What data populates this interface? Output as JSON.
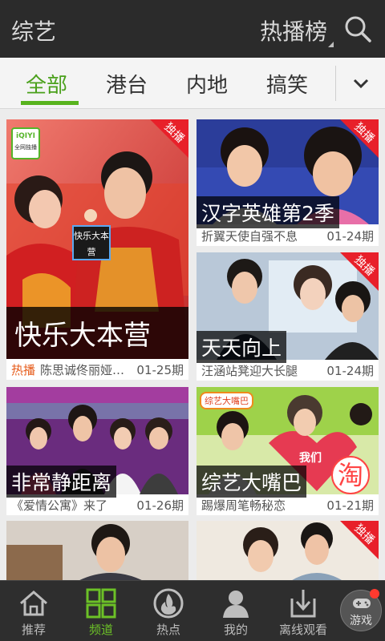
{
  "header": {
    "title": "综艺",
    "rank_label": "热播榜"
  },
  "tabs": [
    {
      "label": "全部",
      "active": true
    },
    {
      "label": "港台"
    },
    {
      "label": "内地"
    },
    {
      "label": "搞笑"
    }
  ],
  "badge_text": "独播",
  "cards": [
    {
      "title": "快乐大本营",
      "hot_label": "热播",
      "desc": "陈思诚佟丽娅",
      "episode": "01-25期",
      "exclusive": true,
      "logo_text": "iQIYI",
      "logo_sub": "全网独播",
      "sign_text": "快乐大本营"
    },
    {
      "title": "汉字英雄第2季",
      "desc": "折翼天使自强不息",
      "episode": "01-24期",
      "exclusive": true
    },
    {
      "title": "天天向上",
      "desc": "汪涵站凳迎大长腿",
      "episode": "01-24期",
      "exclusive": true
    },
    {
      "title": "非常静距离",
      "desc": "《爱情公寓》来了",
      "episode": "01-26期",
      "exclusive": false
    },
    {
      "title": "综艺大嘴巴",
      "desc": "踢爆周笔畅秘恋",
      "episode": "01-21期",
      "exclusive": false,
      "sign_text": "综艺大嘴巴",
      "heart_text": "我们",
      "promo_text": "淘"
    },
    {
      "title": "",
      "desc": "",
      "episode": "",
      "exclusive": false
    },
    {
      "title": "",
      "desc": "",
      "episode": "",
      "exclusive": true
    }
  ],
  "bottom_nav": [
    {
      "label": "推荐",
      "icon": "home-icon"
    },
    {
      "label": "频道",
      "icon": "grid-icon",
      "active": true
    },
    {
      "label": "热点",
      "icon": "flame-icon"
    },
    {
      "label": "我的",
      "icon": "user-icon"
    },
    {
      "label": "离线观看",
      "icon": "download-icon"
    }
  ],
  "game_button": {
    "label": "游戏",
    "icon": "gamepad-icon"
  },
  "colors": {
    "accent": "#58b31d",
    "header_bg": "#2b2b2b",
    "badge_red": "#e8202a",
    "hot_orange": "#e65b1a"
  }
}
